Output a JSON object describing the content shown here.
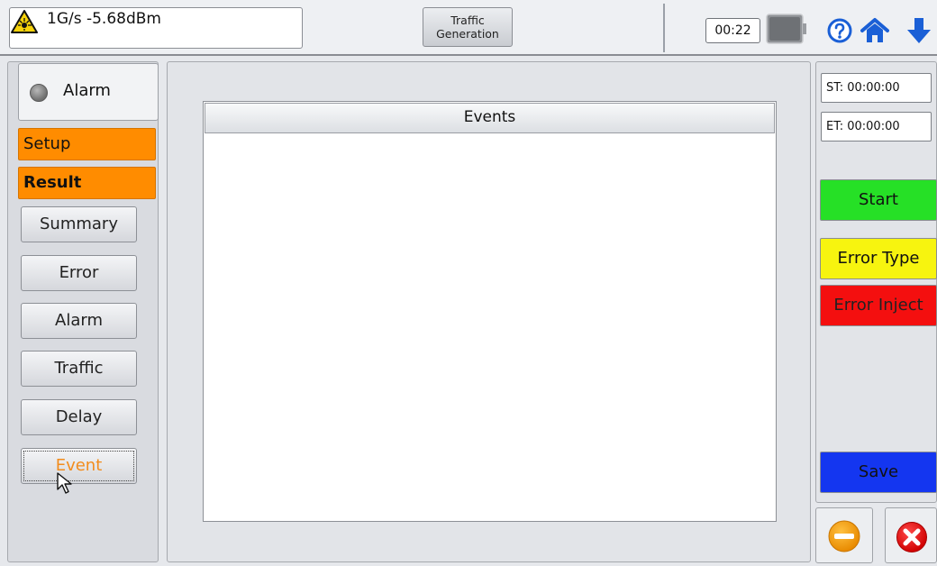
{
  "topbar": {
    "link_status": "1G/s -5.68dBm",
    "mode_line1": "Traffic",
    "mode_line2": "Generation",
    "clock": "00:22",
    "icons": [
      "laser-warning-icon",
      "battery-icon",
      "help-icon",
      "home-icon",
      "download-arrow-icon"
    ]
  },
  "left": {
    "alarm_label": "Alarm",
    "setup": "Setup",
    "result": "Result",
    "nav": [
      "Summary",
      "Error",
      "Alarm",
      "Traffic",
      "Delay",
      "Event"
    ],
    "selected": "Event"
  },
  "center": {
    "table_header": "Events"
  },
  "right": {
    "st": "ST:  00:00:00",
    "et": "ET:  00:00:00",
    "start": "Start",
    "error_type": "Error Type",
    "error_inject": "Error Inject",
    "save": "Save"
  },
  "colors": {
    "menu_head": "#ff8c00",
    "start": "#26e026",
    "error_type": "#f7f40f",
    "error_inject": "#f40f0f",
    "save": "#1436f0",
    "selected_text": "#f28c1c"
  }
}
